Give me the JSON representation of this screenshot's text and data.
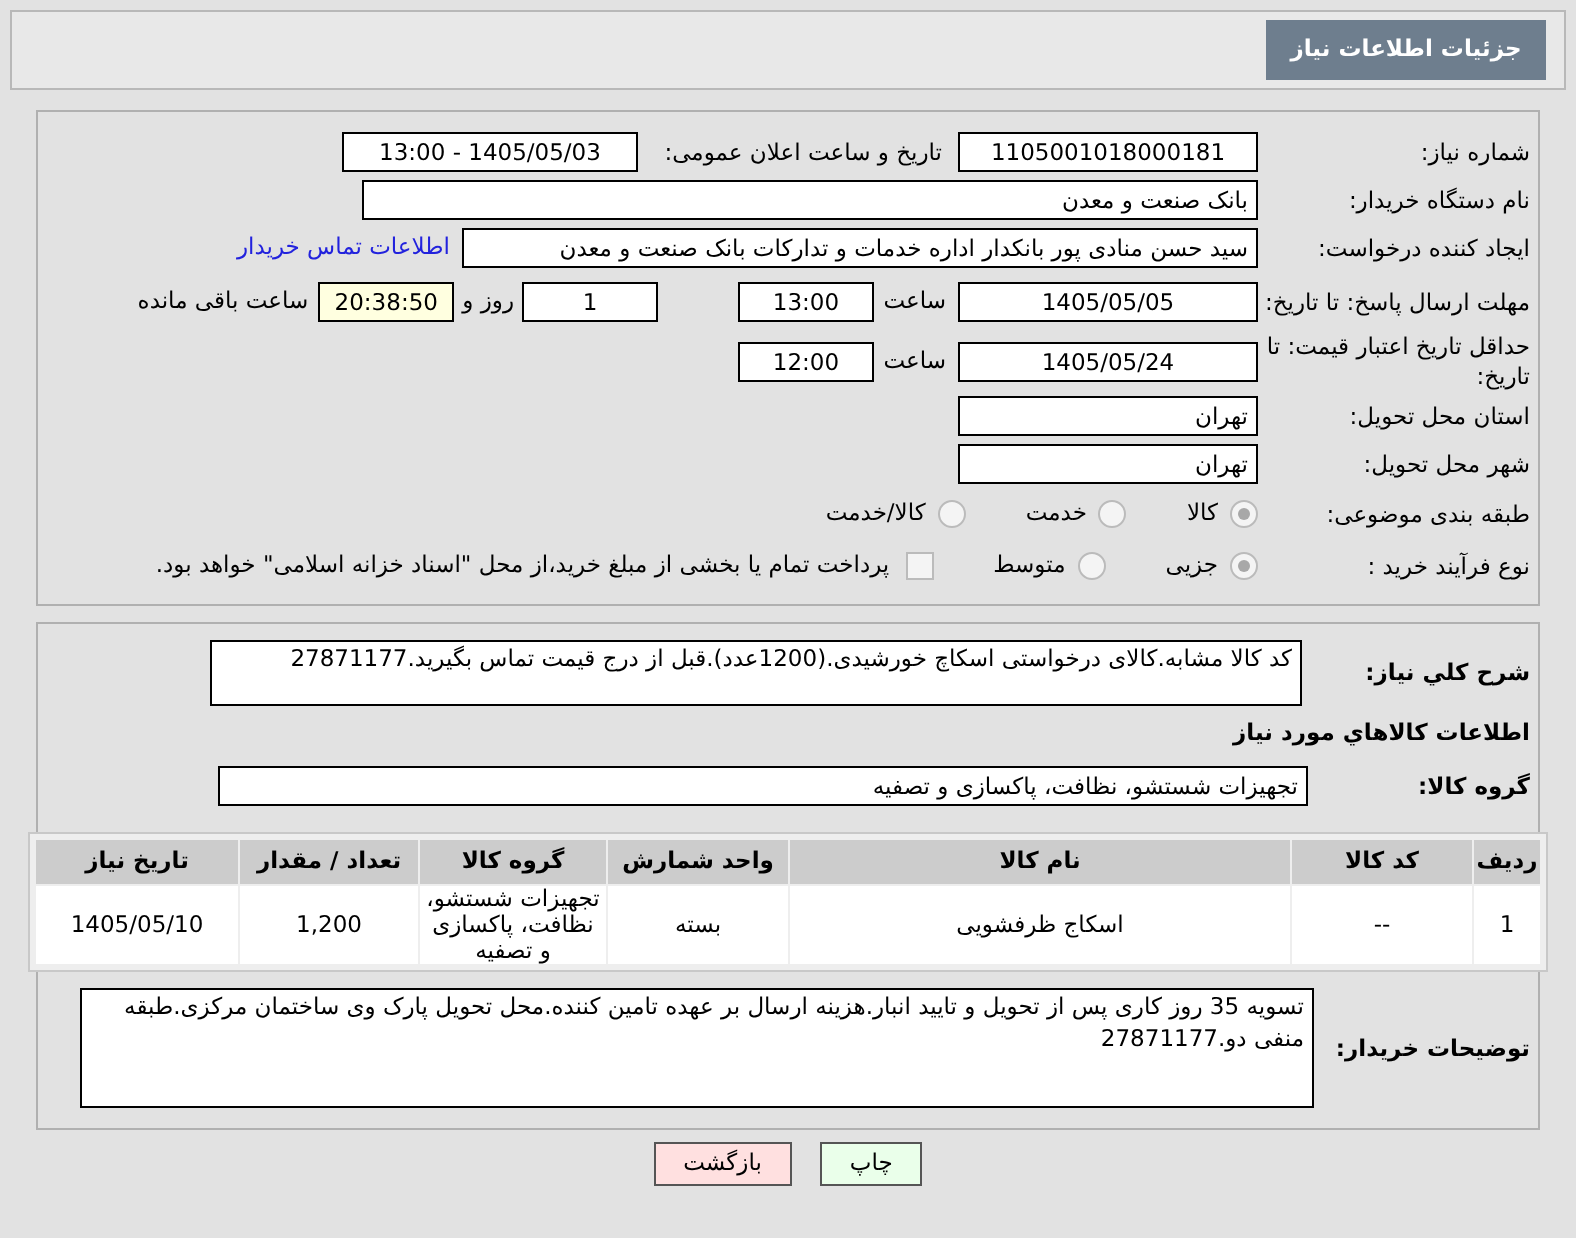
{
  "title": "جزئیات اطلاعات نیاز",
  "need_number": {
    "label": "شماره نیاز:",
    "value": "1105001018000181"
  },
  "announce": {
    "label": "تاریخ و ساعت اعلان عمومی:",
    "value": "1405/05/03 - 13:00"
  },
  "buyer": {
    "label": "نام دستگاه خریدار:",
    "value": "بانک صنعت و معدن"
  },
  "creator": {
    "label": "ایجاد کننده درخواست:",
    "value": "سید حسن منادی پور بانکدار اداره خدمات و تدارکات بانک صنعت و معدن",
    "link": "اطلاعات تماس خریدار"
  },
  "deadline": {
    "label": "مهلت ارسال پاسخ: تا تاریخ:",
    "date": "1405/05/05",
    "time_label": "ساعت",
    "time": "13:00",
    "days": "1",
    "days_label": "روز و",
    "remaining": "20:38:50",
    "remaining_label": "ساعت باقی مانده"
  },
  "validity": {
    "label": "حداقل تاریخ اعتبار قیمت: تا تاریخ:",
    "date": "1405/05/24",
    "time_label": "ساعت",
    "time": "12:00"
  },
  "province": {
    "label": "استان محل تحویل:",
    "value": "تهران"
  },
  "city": {
    "label": "شهر محل تحویل:",
    "value": "تهران"
  },
  "category": {
    "label": "طبقه بندی موضوعی:",
    "options": [
      {
        "label": "کالا",
        "selected": true
      },
      {
        "label": "خدمت",
        "selected": false
      },
      {
        "label": "کالا/خدمت",
        "selected": false
      }
    ]
  },
  "process": {
    "label": "نوع فرآیند خرید :",
    "options": [
      {
        "label": "جزیی",
        "selected": true
      },
      {
        "label": "متوسط",
        "selected": false
      }
    ],
    "payment": {
      "label": "پرداخت تمام یا بخشی از مبلغ خرید،از محل \"اسناد خزانه اسلامی\" خواهد بود.",
      "checked": false
    }
  },
  "description": {
    "label": "شرح کلي نياز:",
    "value": "کد کالا مشابه.کالای درخواستی اسکاچ خورشیدی.(1200عدد).قبل از درج قیمت تماس بگیرید.27871177"
  },
  "goods_heading": "اطلاعات کالاهاي مورد نياز",
  "goods_group": {
    "label": "گروه کالا:",
    "value": "تجهیزات شستشو، نظافت، پاکسازی و تصفیه"
  },
  "table": {
    "columns": [
      "ردیف",
      "کد کالا",
      "نام کالا",
      "واحد شمارش",
      "گروه کالا",
      "تعداد / مقدار",
      "تاریخ نیاز"
    ],
    "rows": [
      [
        "1",
        "--",
        "اسکاج ظرفشویی",
        "بسته",
        "تجهیزات شستشو، نظافت، پاکسازی و تصفیه",
        "1,200",
        "1405/05/10"
      ]
    ]
  },
  "notes": {
    "label": "توضیحات خریدار:",
    "value": "تسویه 35 روز کاری پس از تحویل و تایید انبار.هزینه ارسال بر عهده تامین کننده.محل تحویل پارک وی ساختمان مرکزی.طبقه منفی دو.27871177"
  },
  "buttons": [
    {
      "label": "چاپ",
      "kind": "print"
    },
    {
      "label": "بازگشت",
      "kind": "back"
    }
  ]
}
